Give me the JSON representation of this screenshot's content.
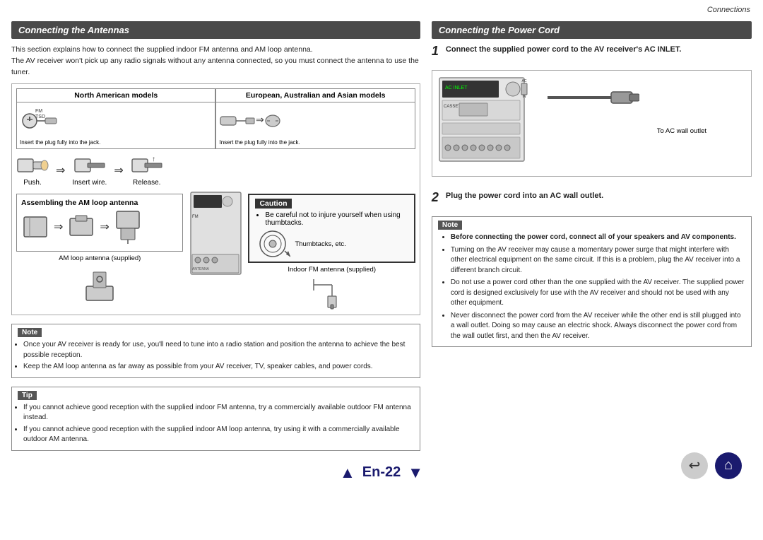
{
  "page": {
    "top_label": "Connections",
    "left_section": {
      "header": "Connecting the Antennas",
      "intro_lines": [
        "This section explains how to connect the supplied indoor FM antenna and AM loop antenna.",
        "The AV receiver won't pick up any radio signals without any antenna connected, so you must connect the antenna to use the tuner."
      ],
      "models_table": {
        "col1_header": "North American models",
        "col2_header": "European, Australian and Asian models",
        "col1_diagram_label": "FM TSD",
        "col1_caption": "Insert the plug fully into the jack.",
        "col2_caption": "Insert the plug fully into the jack."
      },
      "push_row": {
        "push_label": "Push.",
        "insert_label": "Insert wire.",
        "release_label": "Release."
      },
      "am_loop": {
        "title": "Assembling the AM loop antenna",
        "caption": "AM loop antenna (supplied)"
      },
      "caution": {
        "title": "Caution",
        "lines": [
          "Be careful not to injure yourself when using thumbtacks.",
          "Thumbtacks, etc."
        ]
      },
      "indoor_fm_caption": "Indoor FM antenna (supplied)",
      "note": {
        "title": "Note",
        "items": [
          "Once your AV receiver is ready for use, you'll need to tune into a radio station and position the antenna to achieve the best possible reception.",
          "Keep the AM loop antenna as far away as possible from your AV receiver, TV, speaker cables, and power cords."
        ]
      },
      "tip": {
        "title": "Tip",
        "items": [
          "If you cannot achieve good reception with the supplied indoor FM antenna, try a commercially available outdoor FM antenna instead.",
          "If you cannot achieve good reception with the supplied indoor AM loop antenna, try using it with a commercially available outdoor AM antenna."
        ]
      }
    },
    "right_section": {
      "header": "Connecting the Power Cord",
      "step1": {
        "number": "1",
        "text": "Connect the supplied power cord to the AV receiver's AC INLET."
      },
      "diagram": {
        "ac_wall_label": "To AC wall outlet"
      },
      "step2": {
        "number": "2",
        "text": "Plug the power cord into an AC wall outlet."
      },
      "note": {
        "title": "Note",
        "items": [
          "Before connecting the power cord, connect all of your speakers and AV components.",
          "Turning on the AV receiver may cause a momentary power surge that might interfere with other electrical equipment on the same circuit. If this is a problem, plug the AV receiver into a different branch circuit.",
          "Do not use a power cord other than the one supplied with the AV receiver. The supplied power cord is designed exclusively for use with the AV receiver and should not be used with any other equipment.",
          "Never disconnect the power cord from the AV receiver while the other end is still plugged into a wall outlet. Doing so may cause an electric shock. Always disconnect the power cord from the wall outlet first, and then the AV receiver."
        ]
      }
    },
    "bottom": {
      "prev_arrow": "▲",
      "page_label": "En-22",
      "next_arrow": "▼",
      "back_icon": "↩",
      "home_icon": "⌂"
    }
  }
}
